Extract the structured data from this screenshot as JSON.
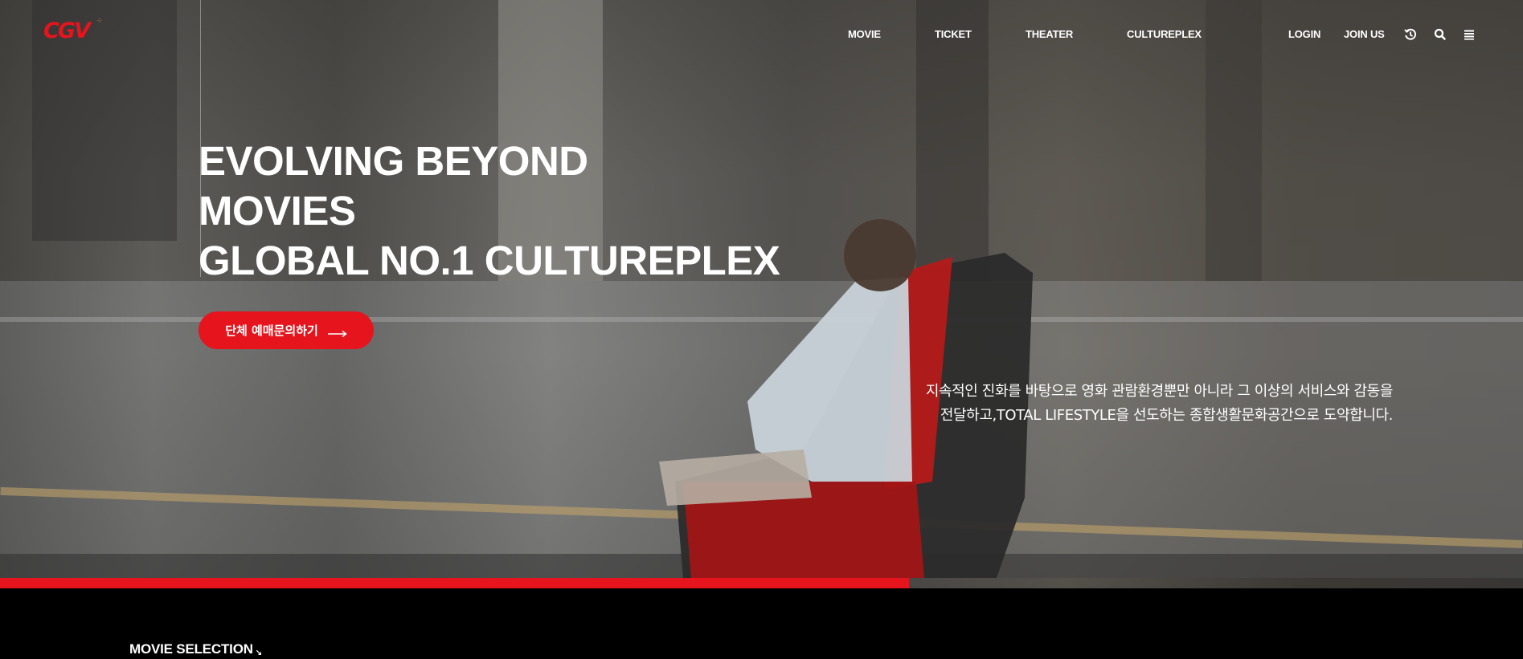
{
  "header": {
    "logo_text": "CGV",
    "nav": [
      {
        "label": "MOVIE"
      },
      {
        "label": "TICKET"
      },
      {
        "label": "THEATER"
      },
      {
        "label": "CULTUREPLEX"
      }
    ],
    "login_label": "LOGIN",
    "join_label": "JOIN US",
    "icons": [
      "history-icon",
      "search-icon",
      "menu-icon"
    ]
  },
  "hero": {
    "headline": [
      "EVOLVING BEYOND",
      "MOVIES",
      "GLOBAL NO.1 CULTUREPLEX"
    ],
    "cta_label": "단체 예매문의하기",
    "description": [
      "지속적인 진화를 바탕으로 영화 관람환경뿐만 아니라 그 이상의 서비스와 감동을",
      "전달하고,TOTAL LIFESTYLE을 선도하는 종합생활문화공간으로 도약합니다."
    ],
    "progress": 0.597
  },
  "section": {
    "movie_selection_label": "MOVIE SELECTION",
    "movie_selection_arrow": "↘"
  },
  "colors": {
    "brand_red": "#e5141d",
    "logo_orange": "#f18b1f",
    "text_white": "#ffffff",
    "background_black": "#000000"
  }
}
